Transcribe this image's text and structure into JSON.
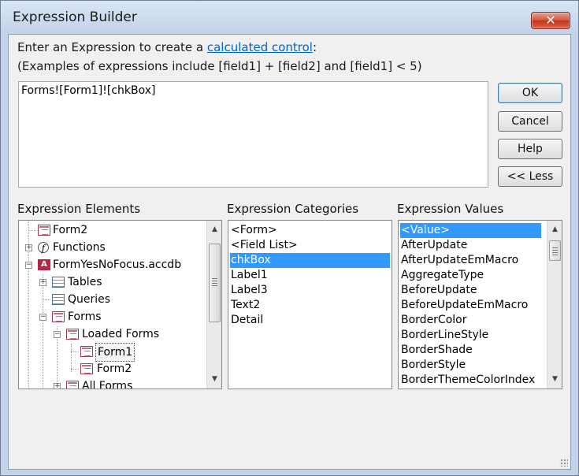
{
  "window": {
    "title": "Expression Builder",
    "close_glyph": "✕"
  },
  "description": {
    "line1_pre": "Enter an Expression to create a ",
    "line1_link": "calculated control",
    "line1_post": ":",
    "line2": "(Examples of expressions include [field1] + [field2] and [field1] < 5)"
  },
  "expression": {
    "value": "Forms![Form1]![chkBox]"
  },
  "buttons": {
    "ok": "OK",
    "cancel": "Cancel",
    "help": "Help",
    "less": "<< Less"
  },
  "elements": {
    "label": "Expression Elements",
    "items": [
      {
        "label": "Form2",
        "icon": "form-icon"
      },
      {
        "label": "Functions",
        "icon": "functions-icon"
      },
      {
        "label": "FormYesNoFocus.accdb",
        "icon": "database-icon"
      },
      {
        "label": "Tables",
        "icon": "table-icon"
      },
      {
        "label": "Queries",
        "icon": "query-icon"
      },
      {
        "label": "Forms",
        "icon": "form-icon"
      },
      {
        "label": "Loaded Forms",
        "icon": "form-icon"
      },
      {
        "label": "Form1",
        "icon": "form-icon",
        "selected": true
      },
      {
        "label": "Form2",
        "icon": "form-icon"
      },
      {
        "label": "All Forms",
        "icon": "form-icon"
      }
    ]
  },
  "categories": {
    "label": "Expression Categories",
    "items": [
      "<Form>",
      "<Field List>",
      "chkBox",
      "Label1",
      "Label3",
      "Text2",
      "Detail"
    ],
    "selected": "chkBox"
  },
  "values": {
    "label": "Expression Values",
    "items": [
      "<Value>",
      "AfterUpdate",
      "AfterUpdateEmMacro",
      "AggregateType",
      "BeforeUpdate",
      "BeforeUpdateEmMacro",
      "BorderColor",
      "BorderLineStyle",
      "BorderShade",
      "BorderStyle",
      "BorderThemeColorIndex"
    ],
    "selected": "<Value>"
  },
  "colors": {
    "selection": "#3399ff",
    "link": "#0066cc",
    "close_button": "#c0341d"
  }
}
